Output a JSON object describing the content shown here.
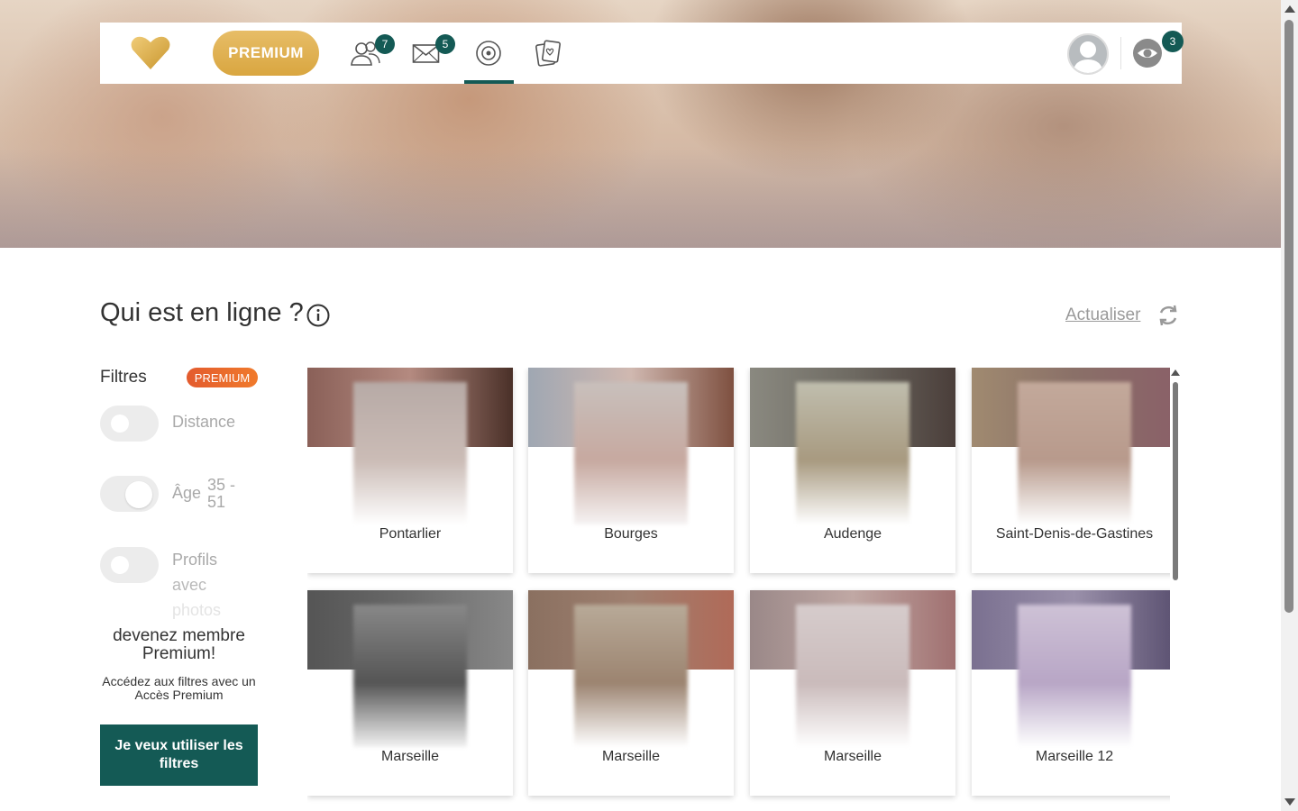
{
  "nav": {
    "premium_label": "PREMIUM",
    "friends_count": "7",
    "messages_count": "5",
    "visitors_count": "3",
    "icons": [
      "logo-heart-icon",
      "contacts-icon",
      "mail-icon",
      "radar-icon",
      "cards-icon",
      "avatar-icon",
      "eye-icon"
    ],
    "accent_color": "#145a55",
    "gold_color": "#dcaa47"
  },
  "main": {
    "title": "Qui est en ligne ?",
    "refresh_label": "Actualiser"
  },
  "filters": {
    "title": "Filtres",
    "premium_badge": "PREMIUM",
    "distance_label": "Distance",
    "distance_enabled": false,
    "age_label": "Âge",
    "age_min": "35 -",
    "age_max": "51",
    "age_enabled": true,
    "photos_label_1": "Profils",
    "photos_label_2": "avec",
    "photos_label_3": "photos",
    "photos_enabled": false
  },
  "promo": {
    "title": "devenez membre Premium!",
    "text": "Accédez aux filtres avec un Accès Premium",
    "cta_label": "Je veux utiliser les filtres"
  },
  "profiles": [
    {
      "city": "Pontarlier",
      "banner": [
        "#8a6058",
        "#b48a80",
        "#4a3028"
      ],
      "photo": [
        "#b7aaa6",
        "#cbbcb6",
        "#ffffff"
      ]
    },
    {
      "city": "Bourges",
      "banner": [
        "#9fa7b2",
        "#d0b8b0",
        "#7e5040"
      ],
      "photo": [
        "#c8c0bc",
        "#c7a9a0",
        "#f6f3f3"
      ]
    },
    {
      "city": "Audenge",
      "banner": [
        "#8a8980",
        "#6e6a62",
        "#4a3e3a"
      ],
      "photo": [
        "#c0beae",
        "#a89a80",
        "#ffffff"
      ]
    },
    {
      "city": "Saint-Denis-de-Gastines",
      "banner": [
        "#a08a70",
        "#8a7068",
        "#8a6068"
      ],
      "photo": [
        "#c3a99b",
        "#b89a8c",
        "#ffffff"
      ]
    },
    {
      "city": "Marseille",
      "banner": [
        "#555555",
        "#6a6a6a",
        "#888888"
      ],
      "photo": [
        "#888888",
        "#555555",
        "#f2f2f2"
      ]
    },
    {
      "city": "Marseille",
      "banner": [
        "#8a7060",
        "#a08070",
        "#b06a58"
      ],
      "photo": [
        "#b8aa98",
        "#9c8470",
        "#ffffff"
      ]
    },
    {
      "city": "Marseille",
      "banner": [
        "#9a8888",
        "#c0a8a4",
        "#a07070"
      ],
      "photo": [
        "#d6cccc",
        "#cabbbb",
        "#ffffff"
      ]
    },
    {
      "city": "Marseille 12",
      "banner": [
        "#7a7090",
        "#9a90aa",
        "#5a5070"
      ],
      "photo": [
        "#cec2d6",
        "#b8a6c6",
        "#ffffff"
      ]
    }
  ]
}
